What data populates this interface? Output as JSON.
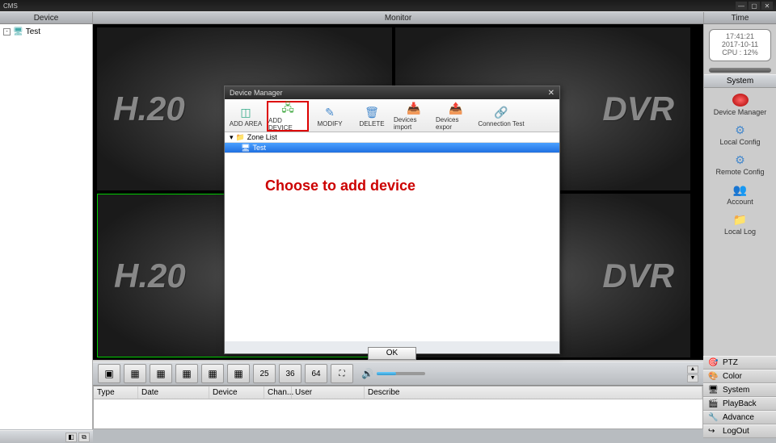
{
  "app_title": "CMS",
  "header": {
    "device": "Device",
    "monitor": "Monitor",
    "time": "Time"
  },
  "tree": {
    "root_label": "Test"
  },
  "clock": {
    "time": "17:41:21",
    "date": "2017-10-11",
    "cpu": "CPU : 12%"
  },
  "system": {
    "header": "System",
    "items": [
      "Device Manager",
      "Local Config",
      "Remote Config",
      "Account",
      "Local Log"
    ]
  },
  "bottom_menu": [
    "PTZ",
    "Color",
    "System",
    "PlayBack",
    "Advance",
    "LogOut"
  ],
  "toolbar_numbers": [
    "25",
    "36",
    "64"
  ],
  "table": {
    "cols": [
      "Type",
      "Date",
      "Device",
      "Chan...",
      "User",
      "Describe"
    ]
  },
  "panes": {
    "left_text": "H.20",
    "right_text": "DVR"
  },
  "dialog": {
    "title": "Device Manager",
    "tools": [
      "ADD AREA",
      "ADD DEVICE",
      "MODIFY",
      "DELETE",
      "Devices import",
      "Devices expor",
      "Connection Test"
    ],
    "zone_root": "Zone List",
    "zone_item": "Test",
    "hint": "Choose to add device",
    "ok": "OK"
  }
}
